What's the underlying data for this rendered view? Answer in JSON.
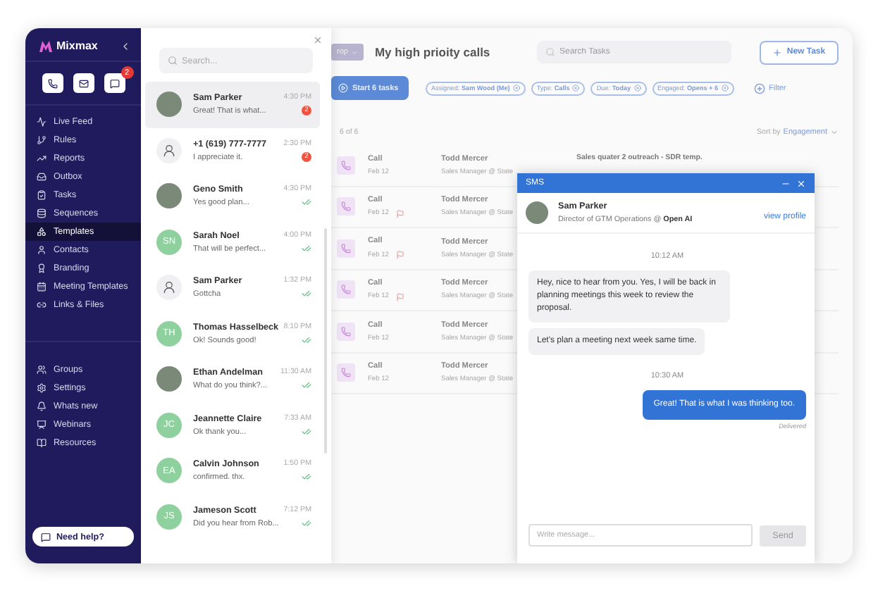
{
  "sidebar": {
    "logo": "Mixmax",
    "message_badge": "2",
    "nav": [
      {
        "label": "Live Feed",
        "selected": false
      },
      {
        "label": "Rules",
        "selected": false
      },
      {
        "label": "Reports",
        "selected": false
      },
      {
        "label": "Outbox",
        "selected": false
      },
      {
        "label": "Tasks",
        "selected": false
      },
      {
        "label": "Sequences",
        "selected": false
      },
      {
        "label": "Templates",
        "selected": true
      },
      {
        "label": "Contacts",
        "selected": false
      },
      {
        "label": "Branding",
        "selected": false
      },
      {
        "label": "Meeting Templates",
        "selected": false
      },
      {
        "label": "Links & Files",
        "selected": false
      }
    ],
    "nav_secondary": [
      {
        "label": "Groups",
        "selected": false
      },
      {
        "label": "Settings",
        "selected": false
      },
      {
        "label": "Whats new",
        "selected": false
      },
      {
        "label": "Webinars",
        "selected": false
      },
      {
        "label": "Resources",
        "selected": false
      }
    ],
    "help_button": "Need help?"
  },
  "conversations": {
    "search": {
      "placeholder": "Search..."
    },
    "items": [
      {
        "name": "Sam Parker",
        "preview": "Great! That is what...",
        "time": "4:30 PM",
        "avatar": {
          "kind": "photo"
        },
        "unread": true,
        "badge": "2",
        "selected": true
      },
      {
        "name": "+1 (619) 777-7777",
        "preview": "I appreciate it.",
        "time": "2:30 PM",
        "avatar": {
          "kind": "person"
        },
        "unread": true,
        "badge": "2",
        "selected": false
      },
      {
        "name": "Geno Smith",
        "preview": "Yes good plan...",
        "time": "4:30 PM",
        "avatar": {
          "kind": "photo"
        },
        "unread": false,
        "selected": false
      },
      {
        "name": "Sarah Noel",
        "preview": "That will be perfect...",
        "time": "4:00 PM",
        "avatar": {
          "kind": "initials",
          "text": "SN"
        },
        "unread": false,
        "selected": false
      },
      {
        "name": "Sam Parker",
        "preview": "Gottcha",
        "time": "1:32 PM",
        "avatar": {
          "kind": "person"
        },
        "unread": false,
        "selected": false
      },
      {
        "name": "Thomas Hasselbeck",
        "preview": "Ok! Sounds good!",
        "time": "8:10 PM",
        "avatar": {
          "kind": "initials",
          "text": "TH"
        },
        "unread": false,
        "selected": false
      },
      {
        "name": "Ethan Andelman",
        "preview": "What do you think?...",
        "time": "11:30 AM",
        "avatar": {
          "kind": "photo"
        },
        "unread": false,
        "selected": false
      },
      {
        "name": "Jeannette Claire",
        "preview": "Ok thank you...",
        "time": "7:33 AM",
        "avatar": {
          "kind": "initials",
          "text": "JC"
        },
        "unread": false,
        "selected": false
      },
      {
        "name": "Calvin Johnson",
        "preview": "confirmed. thx.",
        "time": "1:50 PM",
        "avatar": {
          "kind": "initials",
          "text": "EA"
        },
        "unread": false,
        "selected": false
      },
      {
        "name": "Jameson Scott",
        "preview": "Did you hear from Rob...",
        "time": "7:12 PM",
        "avatar": {
          "kind": "initials",
          "text": "JS"
        },
        "unread": false,
        "selected": false
      }
    ]
  },
  "tasks": {
    "group_chip": "rop",
    "title": "My high prioity calls",
    "search": {
      "placeholder": "Search Tasks"
    },
    "new_task_button": "New Task",
    "start_button": "Start 6 tasks",
    "filters": [
      "Assigned: **Sam Wood (Me)**",
      "Type: **Calls**",
      "Due: **Today**",
      "Engaged: **Opens + 6**"
    ],
    "filter_button": "Filter",
    "count": "6 of 6",
    "sort_label": "Sort by",
    "sort_value": "Engagement",
    "rows": [
      {
        "type": "Call",
        "date": "Feb 12",
        "flagged": false,
        "contact": "Todd Mercer",
        "contact_role": "Sales Manager @ State",
        "subject": "Sales quater 2 outreach - SDR temp."
      },
      {
        "type": "Call",
        "date": "Feb 12",
        "flagged": true,
        "contact": "Todd Mercer",
        "contact_role": "Sales Manager @ State"
      },
      {
        "type": "Call",
        "date": "Feb 12",
        "flagged": true,
        "contact": "Todd Mercer",
        "contact_role": "Sales Manager @ State"
      },
      {
        "type": "Call",
        "date": "Feb 12",
        "flagged": true,
        "contact": "Todd Mercer",
        "contact_role": "Sales Manager @ State"
      },
      {
        "type": "Call",
        "date": "Feb 12",
        "flagged": false,
        "contact": "Todd Mercer",
        "contact_role": "Sales Manager @ State"
      },
      {
        "type": "Call",
        "date": "Feb 12",
        "flagged": false,
        "contact": "Todd Mercer",
        "contact_role": "Sales Manager @ State"
      }
    ]
  },
  "sms": {
    "title": "SMS",
    "contact": {
      "name": "Sam Parker",
      "role": "Director of GTM Operations @ **Open AI**",
      "link": "view profile"
    },
    "messages": [
      {
        "kind": "time",
        "text": "10:12 AM"
      },
      {
        "kind": "incoming",
        "text": "Hey, nice to hear from you. Yes, I will be back in planning meetings this week to review the proposal."
      },
      {
        "kind": "incoming",
        "text": "Let's plan a meeting next week same time."
      },
      {
        "kind": "time",
        "text": "10:30 AM"
      },
      {
        "kind": "outgoing",
        "text": "Great! That is what I was thinking too.",
        "status": "Delivered"
      }
    ],
    "input": {
      "placeholder": "Write message..."
    },
    "send_button": {
      "label": "Send",
      "disabled": true
    }
  }
}
